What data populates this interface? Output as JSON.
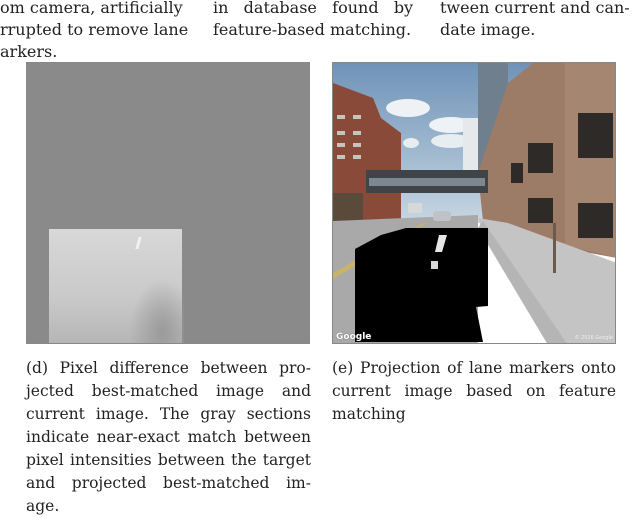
{
  "top_text": {
    "col1": [
      "om camera, artificially",
      "rrupted to remove lane",
      "arkers."
    ],
    "col2": [
      "in   database   found   by",
      "feature-based matching."
    ],
    "col3": [
      "tween current and can-",
      "date image."
    ]
  },
  "figures": {
    "d": {
      "caption_lines": [
        "(d) Pixel difference between pro-",
        "jected best-matched image and",
        "current image. The gray sections",
        "indicate near-exact match between",
        "pixel intensities between the target",
        "and projected best-matched im-",
        "age."
      ]
    },
    "e": {
      "caption_lines": [
        "(e) Projection of lane markers onto",
        "current image based on feature",
        "matching"
      ],
      "watermark": "Google",
      "copyright": "© 2016 Google"
    }
  }
}
